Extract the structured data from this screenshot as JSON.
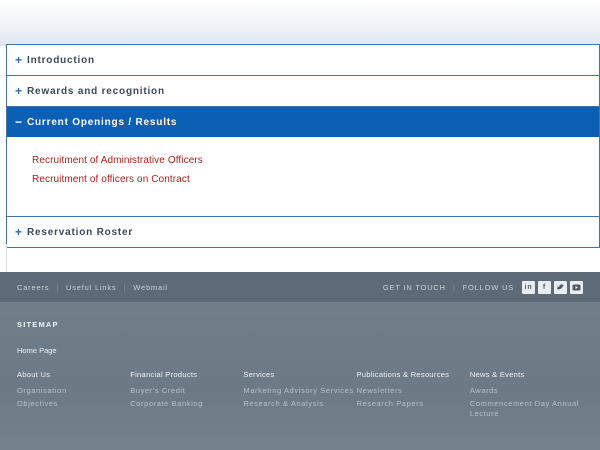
{
  "accordion": {
    "items": [
      {
        "sign": "+",
        "label": "Introduction"
      },
      {
        "sign": "+",
        "label": "Rewards and recognition"
      },
      {
        "sign": "−",
        "label": "Current Openings / Results"
      },
      {
        "sign": "+",
        "label": "Reservation Roster"
      }
    ],
    "open_links": [
      "Recruitment of Administrative Officers",
      "Recruitment of officers on Contract"
    ]
  },
  "footer_bar": {
    "links": [
      "Careers",
      "Useful Links",
      "Webmail"
    ],
    "get_in_touch": "GET IN TOUCH",
    "follow_us": "FOLLOW US",
    "social_icons": [
      "linkedin-icon",
      "facebook-icon",
      "twitter-icon",
      "youtube-icon"
    ]
  },
  "sitemap": {
    "title": "SITEMAP",
    "home": "Home Page",
    "columns": [
      {
        "heading": "About Us",
        "items": [
          "Organisation",
          "Objectives"
        ]
      },
      {
        "heading": "Financial Products",
        "items": [
          "Buyer's Credit",
          "Corporate Banking"
        ]
      },
      {
        "heading": "Services",
        "items": [
          "Marketing Advisory Services",
          "Research & Analysis"
        ]
      },
      {
        "heading": "Publications & Resources",
        "items": [
          "Newsletters",
          "Research Papers"
        ]
      },
      {
        "heading": "News & Events",
        "items": [
          "Awards",
          "Commencement Day Annual Lecture"
        ]
      }
    ]
  },
  "colors": {
    "accent_blue": "#0b5fb5",
    "link_red": "#b0201c",
    "footer_bar": "#5c6b77",
    "sitemap_bg": "#707e89"
  }
}
